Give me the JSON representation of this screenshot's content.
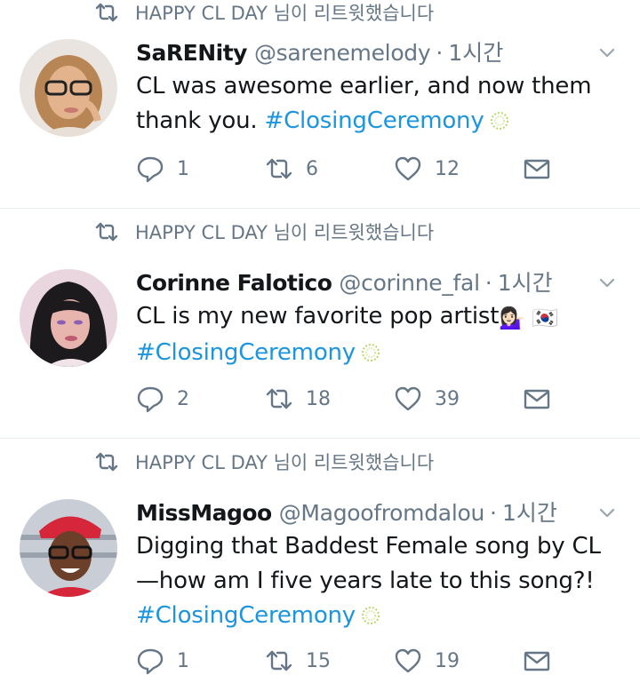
{
  "retweet_label": "HAPPY CL DAY 님이 리트윗했습니다",
  "tweets": [
    {
      "name": "SaRENity",
      "handle": "@sarenemelody",
      "time": "1시간",
      "line1": "CL was awesome earlier, and now them",
      "line2_prefix": "thank you. ",
      "hashtag": "#ClosingCeremony",
      "replies": "1",
      "retweets": "6",
      "likes": "12"
    },
    {
      "name": "Corinne Falotico",
      "handle": "@corinne_fal",
      "time": "1시간",
      "line1": "CL is my new favorite pop artist",
      "hashtag": "#ClosingCeremony",
      "replies": "2",
      "retweets": "18",
      "likes": "39"
    },
    {
      "name": "MissMagoo",
      "handle": "@Magoofromdalou",
      "time": "1시간",
      "line1": "Digging that Baddest Female song by CL",
      "line2": "—how am I five years late to this song?!",
      "hashtag": "#ClosingCeremony",
      "replies": "1",
      "retweets": "15",
      "likes": "19"
    }
  ],
  "icons": {
    "retweet_indicator": "retweet-icon",
    "reply": "reply-icon",
    "retweet": "retweet-icon",
    "like": "heart-icon",
    "dm": "mail-icon",
    "more": "chevron-down-icon",
    "hashtag_emoji": "closing-ceremony-sparkle-icon"
  },
  "colors": {
    "hashtag": "#1b95e0",
    "secondary_text": "#657786",
    "primary_text": "#14171a",
    "divider": "#e6ecf0"
  }
}
